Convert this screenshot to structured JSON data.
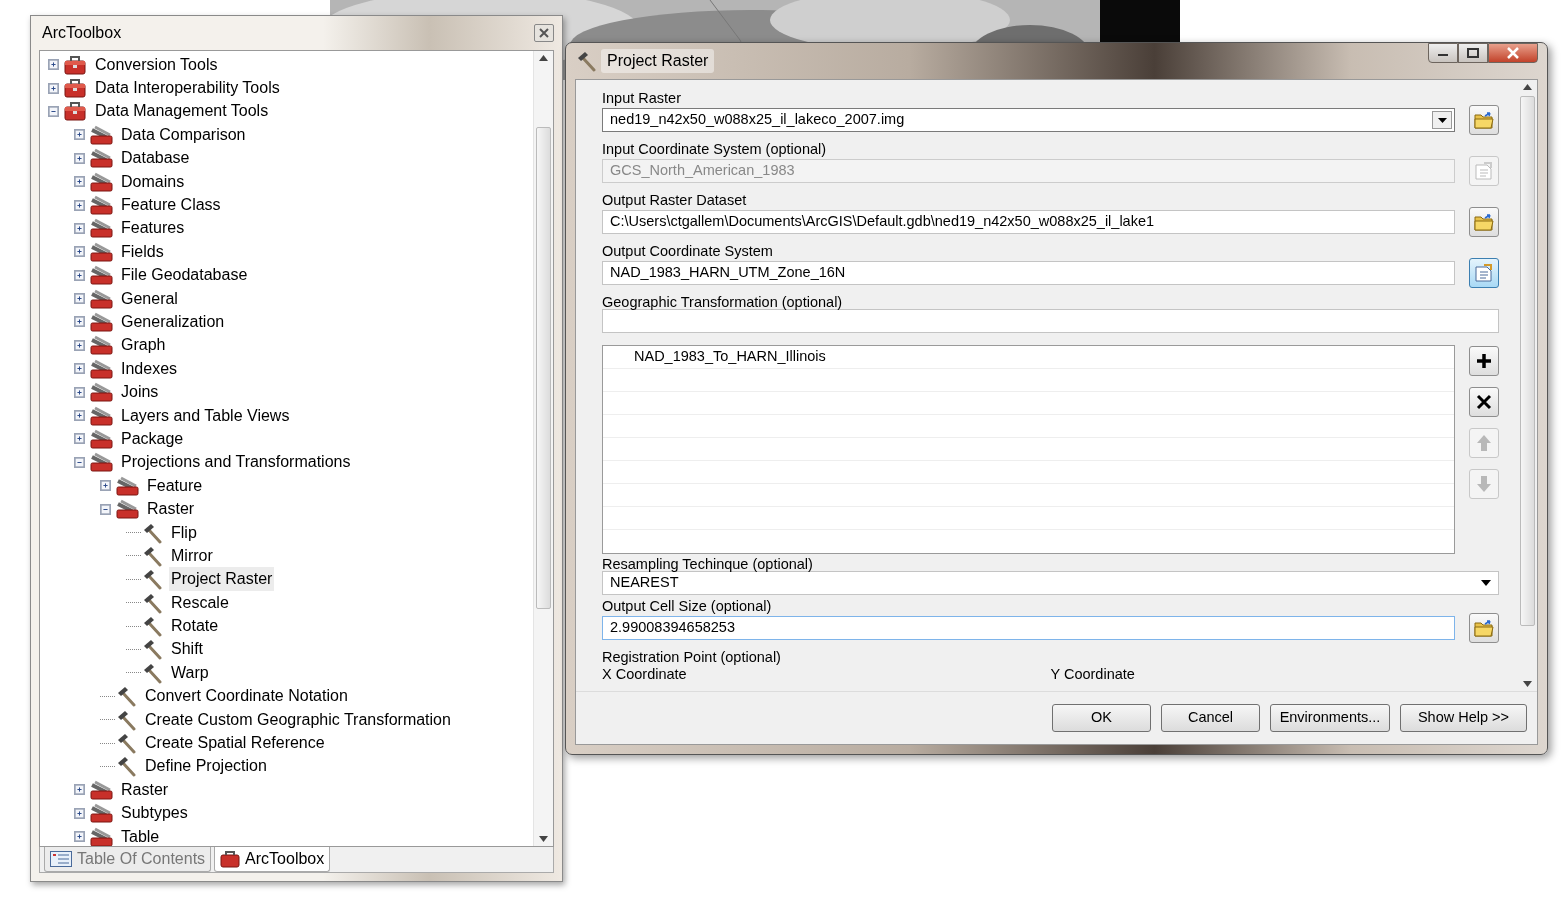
{
  "toolbox_window": {
    "title": "ArcToolbox",
    "tree": [
      {
        "label": "Conversion Tools",
        "kind": "toolbox",
        "expanded": false,
        "selected": false
      },
      {
        "label": "Data Interoperability Tools",
        "kind": "toolbox",
        "expanded": false,
        "selected": false
      },
      {
        "label": "Data Management Tools",
        "kind": "toolbox",
        "expanded": true,
        "selected": false,
        "children": [
          {
            "label": "Data Comparison",
            "kind": "toolset",
            "expanded": false,
            "selected": false
          },
          {
            "label": "Database",
            "kind": "toolset",
            "expanded": false,
            "selected": false
          },
          {
            "label": "Domains",
            "kind": "toolset",
            "expanded": false,
            "selected": false
          },
          {
            "label": "Feature Class",
            "kind": "toolset",
            "expanded": false,
            "selected": false
          },
          {
            "label": "Features",
            "kind": "toolset",
            "expanded": false,
            "selected": false
          },
          {
            "label": "Fields",
            "kind": "toolset",
            "expanded": false,
            "selected": false
          },
          {
            "label": "File Geodatabase",
            "kind": "toolset",
            "expanded": false,
            "selected": false
          },
          {
            "label": "General",
            "kind": "toolset",
            "expanded": false,
            "selected": false
          },
          {
            "label": "Generalization",
            "kind": "toolset",
            "expanded": false,
            "selected": false
          },
          {
            "label": "Graph",
            "kind": "toolset",
            "expanded": false,
            "selected": false
          },
          {
            "label": "Indexes",
            "kind": "toolset",
            "expanded": false,
            "selected": false
          },
          {
            "label": "Joins",
            "kind": "toolset",
            "expanded": false,
            "selected": false
          },
          {
            "label": "Layers and Table Views",
            "kind": "toolset",
            "expanded": false,
            "selected": false
          },
          {
            "label": "Package",
            "kind": "toolset",
            "expanded": false,
            "selected": false
          },
          {
            "label": "Projections and Transformations",
            "kind": "toolset",
            "expanded": true,
            "selected": false,
            "children": [
              {
                "label": "Feature",
                "kind": "toolset",
                "expanded": false,
                "selected": false
              },
              {
                "label": "Raster",
                "kind": "toolset",
                "expanded": true,
                "selected": false,
                "children": [
                  {
                    "label": "Flip",
                    "kind": "tool",
                    "selected": false
                  },
                  {
                    "label": "Mirror",
                    "kind": "tool",
                    "selected": false
                  },
                  {
                    "label": "Project Raster",
                    "kind": "tool",
                    "selected": true
                  },
                  {
                    "label": "Rescale",
                    "kind": "tool",
                    "selected": false
                  },
                  {
                    "label": "Rotate",
                    "kind": "tool",
                    "selected": false
                  },
                  {
                    "label": "Shift",
                    "kind": "tool",
                    "selected": false
                  },
                  {
                    "label": "Warp",
                    "kind": "tool",
                    "selected": false
                  }
                ]
              },
              {
                "label": "Convert Coordinate Notation",
                "kind": "tool",
                "selected": false
              },
              {
                "label": "Create Custom Geographic Transformation",
                "kind": "tool",
                "selected": false
              },
              {
                "label": "Create Spatial Reference",
                "kind": "tool",
                "selected": false
              },
              {
                "label": "Define Projection",
                "kind": "tool",
                "selected": false
              }
            ]
          },
          {
            "label": "Raster",
            "kind": "toolset",
            "expanded": false,
            "selected": false
          },
          {
            "label": "Subtypes",
            "kind": "toolset",
            "expanded": false,
            "selected": false
          },
          {
            "label": "Table",
            "kind": "toolset",
            "expanded": false,
            "selected": false
          }
        ]
      }
    ],
    "tabs": [
      {
        "label": "Table Of Contents",
        "kind": "contents",
        "selected": false
      },
      {
        "label": "ArcToolbox",
        "kind": "toolbox",
        "selected": true
      }
    ]
  },
  "dialog": {
    "title": "Project Raster",
    "parameters": [
      {
        "kind": "combo",
        "label": "Input Raster",
        "value": "ned19_n42x50_w088x25_il_lakeco_2007.img",
        "disabled": false,
        "focused": false,
        "button": {
          "kind": "browse",
          "disabled": false,
          "highlighted": false
        }
      },
      {
        "kind": "text",
        "label": "Input Coordinate System (optional)",
        "value": "GCS_North_American_1983",
        "disabled": true,
        "focused": false,
        "button": {
          "kind": "coord",
          "disabled": true,
          "highlighted": false
        }
      },
      {
        "kind": "text",
        "label": "Output Raster Dataset",
        "value": "C:\\Users\\ctgallem\\Documents\\ArcGIS\\Default.gdb\\ned19_n42x50_w088x25_il_lake1",
        "disabled": false,
        "focused": false,
        "button": {
          "kind": "browse",
          "disabled": false,
          "highlighted": false
        }
      },
      {
        "kind": "text",
        "label": "Output Coordinate System",
        "value": "NAD_1983_HARN_UTM_Zone_16N",
        "disabled": false,
        "focused": false,
        "button": {
          "kind": "coord",
          "disabled": false,
          "highlighted": true
        }
      },
      {
        "kind": "list",
        "label": "Geographic Transformation (optional)",
        "items": [
          "NAD_1983_To_HARN_Illinois"
        ],
        "list_buttons": [
          {
            "kind": "add",
            "disabled": false
          },
          {
            "kind": "remove",
            "disabled": false
          },
          {
            "kind": "up",
            "disabled": true
          },
          {
            "kind": "down",
            "disabled": true
          }
        ]
      },
      {
        "kind": "select",
        "label": "Resampling Techinque (optional)",
        "value": "NEAREST"
      },
      {
        "kind": "text",
        "label": "Output Cell Size (optional)",
        "value": "2.99008394658253",
        "disabled": false,
        "focused": true,
        "button": {
          "kind": "browse",
          "disabled": false,
          "highlighted": false
        }
      },
      {
        "kind": "point",
        "label": "Registration Point (optional)",
        "x_label": "X Coordinate",
        "y_label": "Y Coordinate"
      }
    ],
    "buttons": [
      "OK",
      "Cancel",
      "Environments...",
      "Show Help >>"
    ]
  }
}
